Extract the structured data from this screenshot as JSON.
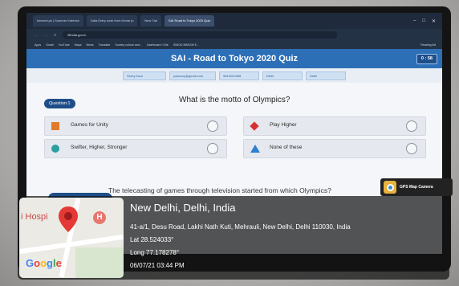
{
  "browser": {
    "tabs": [
      "Internet.pk | Summer Internsh",
      "Data Entry work from Home jo",
      "New Tab",
      "SAI Road to Tokyo 2020 Quiz"
    ],
    "url": "fitindia.gov.in",
    "bookmarks": [
      "Apps",
      "Gmail",
      "YouTube",
      "Maps",
      "News",
      "Translate",
      "Society culture and...",
      "Dashboard / Kite",
      "IGNOU IBM/GM E..."
    ],
    "reading_list": "Reading list"
  },
  "quiz": {
    "title": "SAI - Road to Tokyo 2020 Quiz",
    "timer": "0 : 58",
    "user_fields": [
      "Shrey Kaur",
      "yukanoy@gmail.com",
      "9810202358",
      "Delhi",
      "Delhi"
    ],
    "question_label": "Question:1",
    "question_text": "What is the motto of Olympics?",
    "options": [
      {
        "label": "Games for Unity",
        "shape": "square-icon",
        "color": "#e07b2c"
      },
      {
        "label": "Play Higher",
        "shape": "diamond-icon",
        "color": "#d83030"
      },
      {
        "label": "Swifter, Higher, Stronger",
        "shape": "circle-icon",
        "color": "#2aa0a0"
      },
      {
        "label": "None of these",
        "shape": "triangle-icon",
        "color": "#2d7fd0"
      }
    ],
    "next_question_text": "The telecasting of games through television started from which Olympics?"
  },
  "gps": {
    "badge": "GPS Map Camera",
    "map_place": "i Hospi",
    "map_icon": "H",
    "google": "Google",
    "city": "New Delhi, Delhi, India",
    "address": "41-a/1, Desu Road, Lakhi Nath Kuti, Mehrauli, New Delhi, Delhi 110030, India",
    "lat": "Lat 28.524033°",
    "long": "Long 77.178278°",
    "datetime": "06/07/21 03:44 PM"
  }
}
